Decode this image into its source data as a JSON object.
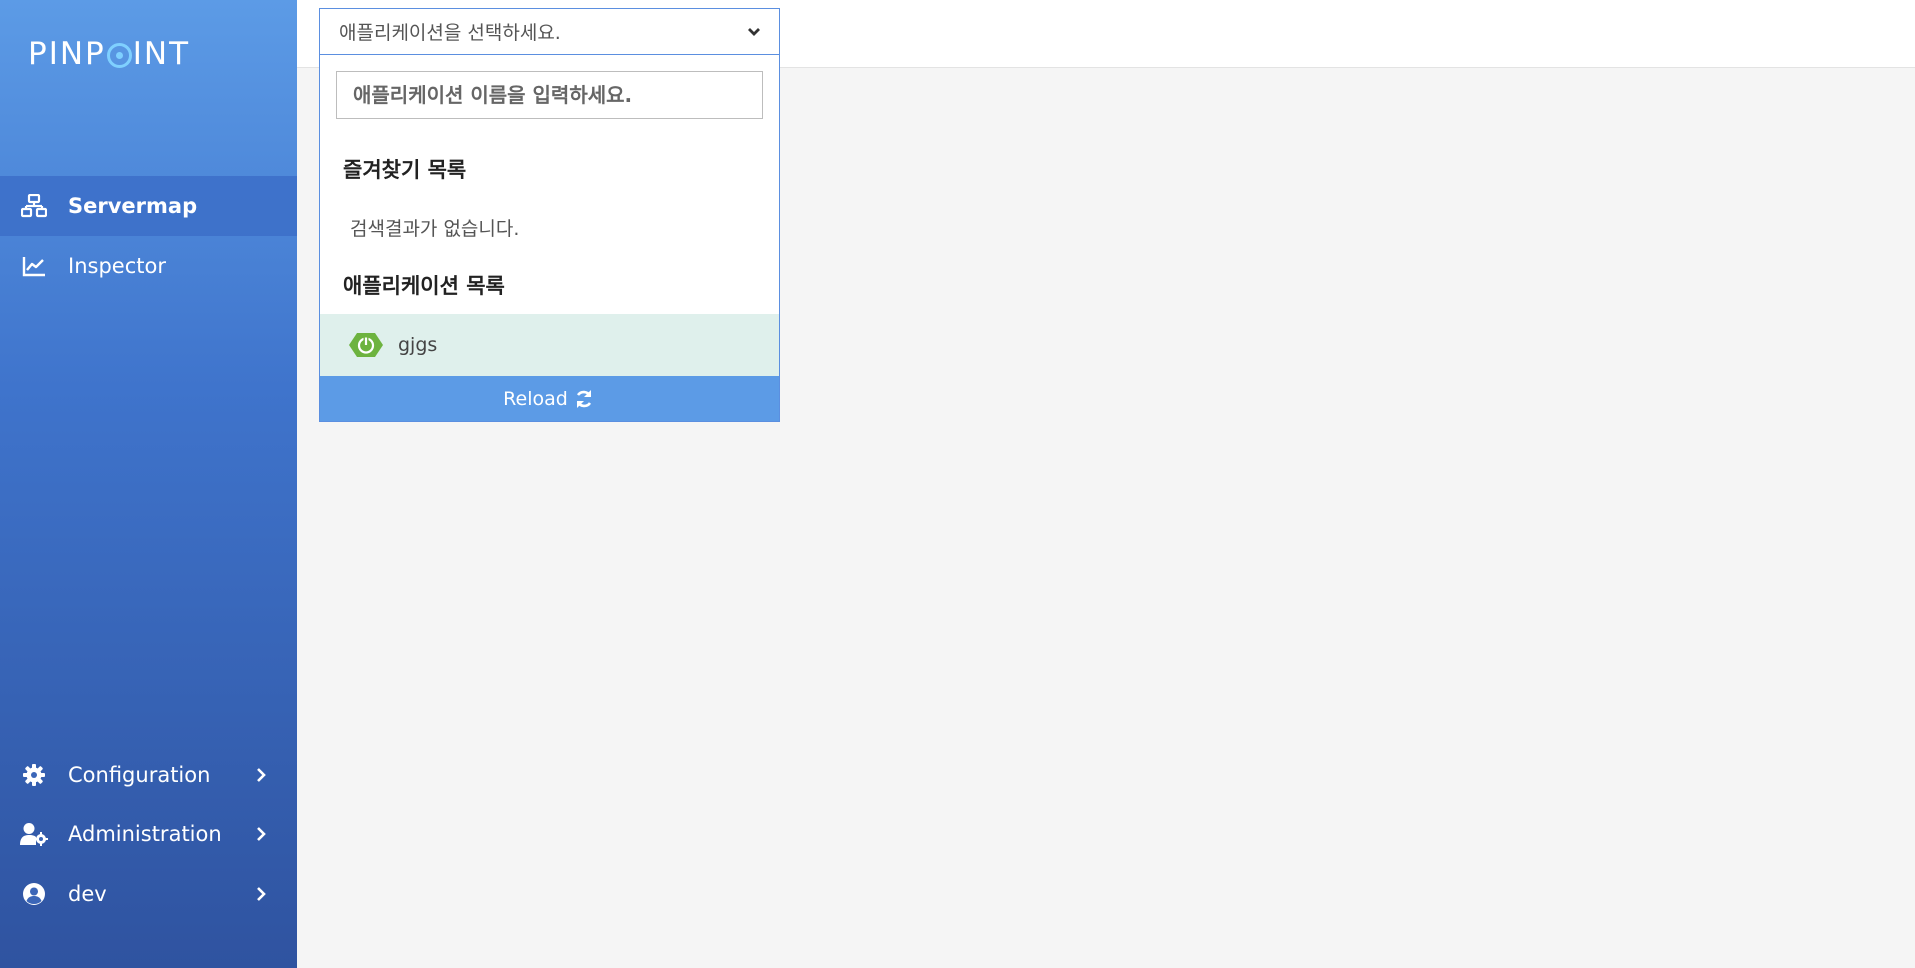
{
  "brand": {
    "logo_prefix": "PINP",
    "logo_suffix": "INT"
  },
  "sidebar": {
    "items": [
      {
        "label": "Servermap",
        "icon": "servermap-icon",
        "active": true
      },
      {
        "label": "Inspector",
        "icon": "chart-line-icon",
        "active": false
      }
    ],
    "bottom_items": [
      {
        "label": "Configuration",
        "icon": "gear-icon"
      },
      {
        "label": "Administration",
        "icon": "user-gear-icon"
      },
      {
        "label": "dev",
        "icon": "user-circle-icon"
      }
    ]
  },
  "selector": {
    "placeholder": "애플리케이션을 선택하세요.",
    "search_placeholder": "애플리케이션 이름을 입력하세요.",
    "favorites_title": "즐겨찾기 목록",
    "favorites_empty": "검색결과가 없습니다.",
    "apps_title": "애플리케이션 목록",
    "apps": [
      {
        "name": "gjgs",
        "icon": "spring-boot-icon"
      }
    ],
    "reload_label": "Reload"
  },
  "colors": {
    "accent": "#5c9be6",
    "sidebar_top": "#5c9be6",
    "sidebar_bottom": "#2f53a0",
    "selected_row": "#dff0ec",
    "spring_green": "#6db33f"
  }
}
